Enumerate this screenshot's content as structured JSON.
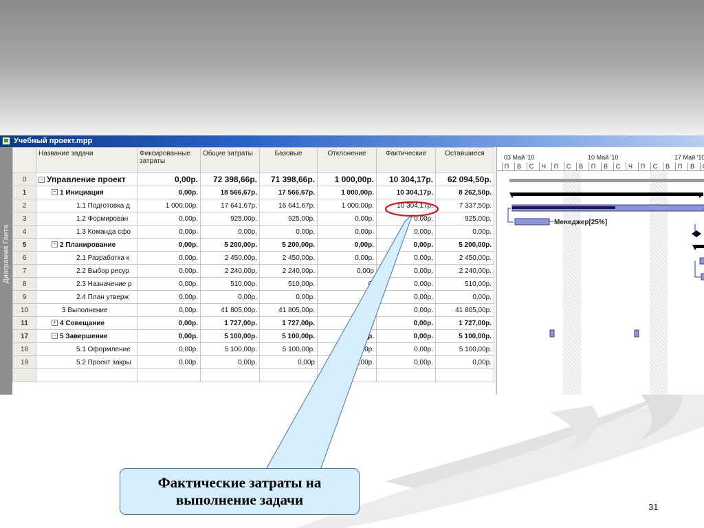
{
  "window": {
    "title": "Учебный проект.mpp",
    "view_label": "Диаграмма Ганта"
  },
  "columns": {
    "id": "",
    "name": "Название задачи",
    "fixed": "Фиксированные затраты",
    "total": "Общие затраты",
    "base": "Базовые",
    "variance": "Отклонение",
    "actual": "Фактические",
    "remaining": "Оставшиеся"
  },
  "rows": [
    {
      "id": "0",
      "toggle": "−",
      "name": "Управление проект",
      "fixed": "0,00р.",
      "total": "72 398,66р.",
      "base": "71 398,66р.",
      "variance": "1 000,00р.",
      "actual": "10 304,17р.",
      "remaining": "62 094,50р."
    },
    {
      "id": "1",
      "toggle": "−",
      "name": "1 Инициация",
      "fixed": "0,00р.",
      "total": "18 566,67р.",
      "base": "17 566,67р.",
      "variance": "1 000,00р.",
      "actual": "10 304,17р.",
      "remaining": "8 262,50р."
    },
    {
      "id": "2",
      "name": "1.1 Подготовка д",
      "fixed": "1 000,00р.",
      "total": "17 641,67р.",
      "base": "16 641,67р.",
      "variance": "1 000,00р.",
      "actual": "10 304,17р.",
      "remaining": "7 337,50р."
    },
    {
      "id": "3",
      "name": "1.2 Формирован",
      "fixed": "0,00р.",
      "total": "925,00р.",
      "base": "925,00р.",
      "variance": "0,00р.",
      "actual": "0,00р.",
      "remaining": "925,00р."
    },
    {
      "id": "4",
      "name": "1.3 Команда сфо",
      "fixed": "0,00р.",
      "total": "0,00р.",
      "base": "0,00р.",
      "variance": "0,00р.",
      "actual": "0,00р.",
      "remaining": "0,00р."
    },
    {
      "id": "5",
      "toggle": "−",
      "name": "2 Планирование",
      "fixed": "0,00р.",
      "total": "5 200,00р.",
      "base": "5 200,00р.",
      "variance": "0,00р.",
      "actual": "0,00р.",
      "remaining": "5 200,00р."
    },
    {
      "id": "6",
      "name": "2.1 Разработка к",
      "fixed": "0,00р.",
      "total": "2 450,00р.",
      "base": "2 450,00р.",
      "variance": "0,00р.",
      "actual": "0,00р.",
      "remaining": "2 450,00р."
    },
    {
      "id": "7",
      "name": "2.2 Выбор ресур",
      "fixed": "0,00р.",
      "total": "2 240,00р.",
      "base": "2 240,00р.",
      "variance": "0,00р",
      "actual": "0,00р.",
      "remaining": "2 240,00р."
    },
    {
      "id": "8",
      "name": "2.3 Назначение р",
      "fixed": "0,00р.",
      "total": "510,00р.",
      "base": "510,00р.",
      "variance": "0,",
      "actual": "0,00р.",
      "remaining": "510,00р."
    },
    {
      "id": "9",
      "name": "2.4 План утверж",
      "fixed": "0,00р.",
      "total": "0,00р.",
      "base": "0,00р.",
      "variance": "0",
      "actual": "0,00р.",
      "remaining": "0,00р."
    },
    {
      "id": "10",
      "name": "3 Выполнение",
      "fixed": "0,00р.",
      "total": "41 805,00р.",
      "base": "41 805,00р.",
      "variance": "",
      "actual": "0,00р.",
      "remaining": "41 805,00р."
    },
    {
      "id": "11",
      "toggle": "+",
      "name": "4 Совещание",
      "fixed": "0,00р.",
      "total": "1 727,00р.",
      "base": "1 727,00р.",
      "variance": "р.",
      "actual": "0,00р.",
      "remaining": "1 727,00р."
    },
    {
      "id": "17",
      "toggle": "−",
      "name": "5 Завершение",
      "fixed": "0,00р.",
      "total": "5 100,00р.",
      "base": "5 100,00р.",
      "variance": "0р.",
      "actual": "0,00р.",
      "remaining": "5 100,00р."
    },
    {
      "id": "18",
      "name": "5.1 Оформление",
      "fixed": "0,00р.",
      "total": "5 100,00р.",
      "base": "5 100,00р.",
      "variance": "00р.",
      "actual": "0,00р.",
      "remaining": "5 100,00р."
    },
    {
      "id": "19",
      "name": "5.2 Проект закры",
      "fixed": "0,00р.",
      "total": "0,00р.",
      "base": "0,00р",
      "variance": "0,00р.",
      "actual": "0,00р.",
      "remaining": "0,00р."
    }
  ],
  "gantt": {
    "weeks": [
      "03 Май '10",
      "10 Май '10",
      "17 Май '10"
    ],
    "days": [
      "П",
      "В",
      "С",
      "Ч",
      "П",
      "С",
      "В",
      "П",
      "В",
      "С",
      "Ч",
      "П",
      "С",
      "В",
      "П",
      "В",
      "С"
    ],
    "resource_label": "Менеджер[25%]"
  },
  "callout": {
    "line1": "Фактические затраты на",
    "line2": "выполнение задачи"
  },
  "page_number": "31",
  "colors": {
    "titlebar": "#2a63c8",
    "bar_fill": "#8f95d8",
    "highlight_oval": "#d8141e",
    "callout_fill": "#d4eefb"
  }
}
